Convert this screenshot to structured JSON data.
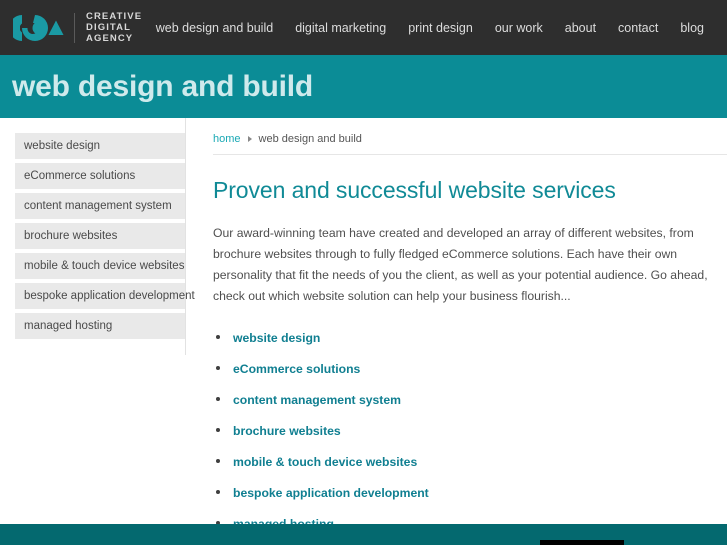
{
  "header": {
    "logo": {
      "icon": "cda-logo-icon",
      "lines": [
        "CREATIVE",
        "DIGITAL",
        "AGENCY"
      ]
    },
    "nav_items": [
      {
        "label": "web design and build"
      },
      {
        "label": "digital marketing"
      },
      {
        "label": "print design"
      },
      {
        "label": "our work"
      },
      {
        "label": "about"
      },
      {
        "label": "contact"
      },
      {
        "label": "blog"
      }
    ]
  },
  "banner": {
    "title": "web design and build"
  },
  "sidebar": {
    "items": [
      {
        "label": "website design"
      },
      {
        "label": "eCommerce solutions"
      },
      {
        "label": "content management system"
      },
      {
        "label": "brochure websites"
      },
      {
        "label": "mobile & touch device websites"
      },
      {
        "label": "bespoke application development"
      },
      {
        "label": "managed hosting"
      }
    ]
  },
  "main": {
    "breadcrumb": {
      "home_label": "home",
      "separator": "triangle-right-icon",
      "current_label": "web design and build"
    },
    "heading": "Proven and successful website services",
    "paragraph": "Our award-winning team have created and developed an array of different websites, from brochure websites through to fully fledged eCommerce solutions. Each have their own personality that fit the needs of you the client, as well as your potential audience. Go ahead, check out which website solution can help your business flourish...",
    "links": [
      {
        "label": "website design"
      },
      {
        "label": "eCommerce solutions"
      },
      {
        "label": "content management system"
      },
      {
        "label": "brochure websites"
      },
      {
        "label": "mobile & touch device websites"
      },
      {
        "label": "bespoke application development"
      },
      {
        "label": "managed hosting"
      }
    ]
  },
  "colors": {
    "header_bg": "#2e2e2e",
    "banner_bg": "#0b8c96",
    "banner_text": "#cfeaec",
    "accent_teal": "#108a96",
    "link_teal": "#107f91",
    "footer_bg": "#04696f",
    "sidebar_item_bg": "#e9e9e9"
  }
}
